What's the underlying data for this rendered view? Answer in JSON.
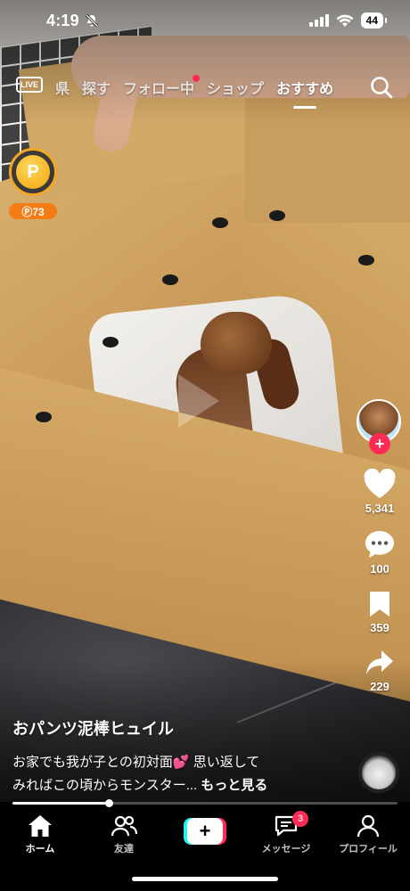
{
  "status_bar": {
    "time": "4:19",
    "battery": "44",
    "icons": [
      "bell-slash-icon",
      "signal-icon",
      "wifi-icon",
      "battery-icon"
    ]
  },
  "top_nav": {
    "live_label": "LIVE",
    "tabs": [
      {
        "label": "県",
        "active": false
      },
      {
        "label": "探す",
        "active": false
      },
      {
        "label": "フォロー中",
        "active": false,
        "has_dot": true
      },
      {
        "label": "ショップ",
        "active": false
      },
      {
        "label": "おすすめ",
        "active": true
      }
    ]
  },
  "coin": {
    "symbol": "P",
    "badge": "Ⓟ73"
  },
  "rail": {
    "follow_symbol": "+",
    "likes": "5,341",
    "comments": "100",
    "saves": "359",
    "shares": "229"
  },
  "caption": {
    "author": "おパンツ泥棒ヒュイル",
    "line1": "お家でも我が子との初対面💕 思い返して",
    "line2": "みればこの頃からモンスター...",
    "more": "もっと見る"
  },
  "playback": {
    "progress": 0.25
  },
  "tabbar": {
    "home": "ホーム",
    "friends": "友達",
    "create_symbol": "+",
    "messages": "メッセージ",
    "messages_badge": "3",
    "profile": "プロフィール"
  },
  "colors": {
    "accent": "#fe2c55",
    "accent2": "#25f4ee",
    "coin": "#f5a524"
  }
}
